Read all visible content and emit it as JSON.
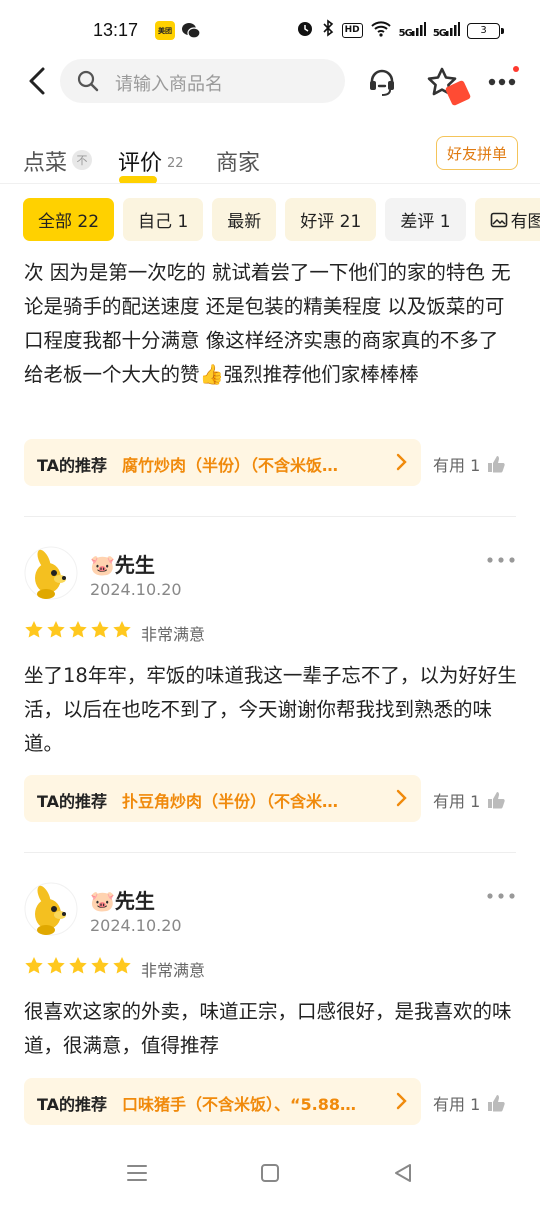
{
  "status_bar": {
    "time": "13:17",
    "app_badges": [
      "美团",
      "wechat-icon"
    ],
    "icons": [
      "alarm-icon",
      "bluetooth-icon",
      "hd-icon",
      "wifi-icon",
      "signal-5g-icon",
      "signal-5g-icon"
    ],
    "hd": "HD",
    "sig1": "5G",
    "sig2": "5G",
    "battery": "3"
  },
  "header": {
    "search_placeholder": "请输入商品名",
    "icons": [
      "back-icon",
      "search-icon",
      "customer-service-icon",
      "favorite-star-icon",
      "more-icon"
    ]
  },
  "tabs": [
    {
      "label": "点菜"
    },
    {
      "label": "评价",
      "count": "22"
    },
    {
      "label": "商家"
    }
  ],
  "tab_pin": "不",
  "group_button": "好友拼单",
  "filters": [
    {
      "label": "全部 22",
      "active": true
    },
    {
      "label": "自己 1"
    },
    {
      "label": "最新"
    },
    {
      "label": "好评 21"
    },
    {
      "label": "差评 1"
    },
    {
      "label": "有图"
    }
  ],
  "reviews": [
    {
      "text": "次 因为是第一次吃的 就试着尝了一下他们的家的特色 无论是骑手的配送速度 还是包装的精美程度 以及饭菜的可口程度我都十分满意 像这样经济实惠的商家真的不多了 给老板一个大大的赞👍强烈推荐他们家棒棒棒",
      "rec_label": "TA的推荐",
      "rec_dishes": "腐竹炒肉（半份）（不含米饭…",
      "helpful": "有用 1"
    },
    {
      "user": "🐷先生",
      "date": "2024.10.20",
      "rating": 5,
      "rating_label": "非常满意",
      "text": "坐了18年牢，牢饭的味道我这一辈子忘不了，以为好好生活，以后在也吃不到了，今天谢谢你帮我找到熟悉的味道。",
      "rec_label": "TA的推荐",
      "rec_dishes": "扑豆角炒肉（半份）（不含米…",
      "helpful": "有用 1"
    },
    {
      "user": "🐷先生",
      "date": "2024.10.20",
      "rating": 5,
      "rating_label": "非常满意",
      "text": "很喜欢这家的外卖，味道正宗，口感很好，是我喜欢的味道，很满意，值得推荐",
      "rec_label": "TA的推荐",
      "rec_dishes": "口味猪手（不含米饭）、“5.88…",
      "helpful": "有用 1"
    }
  ],
  "nav": [
    "menu-icon",
    "home-icon",
    "back-triangle-icon"
  ],
  "colors": {
    "accent_yellow": "#ffd100",
    "chip_bg": "#fbf4df",
    "orange": "#f08a0c",
    "star": "#ffc81e"
  }
}
